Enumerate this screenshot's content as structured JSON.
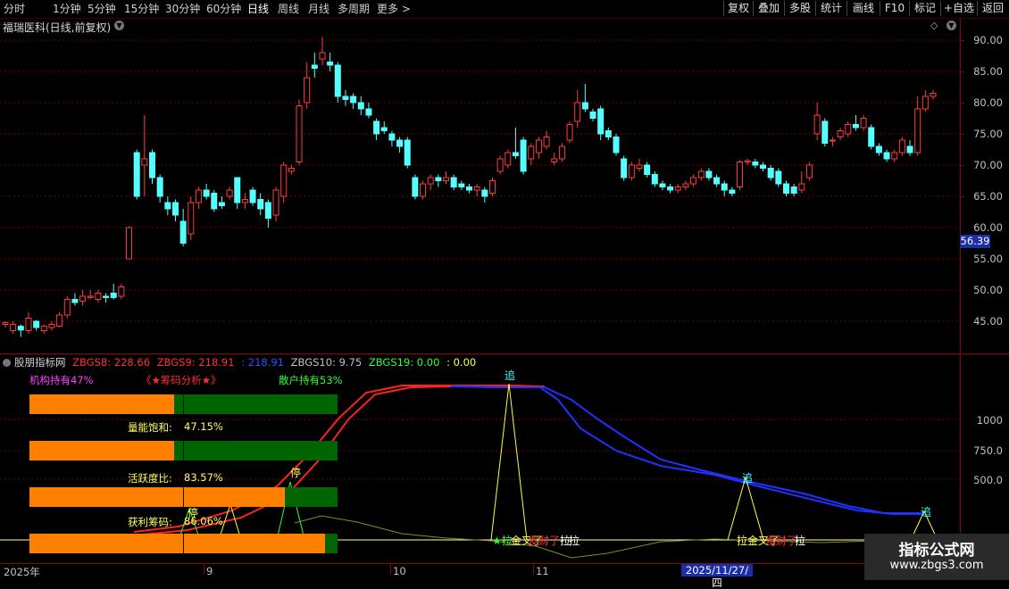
{
  "toolbar": {
    "periods": [
      "分时",
      "1分钟",
      "5分钟",
      "15分钟",
      "30分钟",
      "60分钟",
      "日线",
      "周线",
      "月线",
      "多周期",
      "更多 >"
    ],
    "active_period": "日线",
    "right_buttons": [
      "复权",
      "叠加",
      "多股",
      "统计",
      "画线",
      "F10",
      "标记",
      "+自选",
      "返回"
    ]
  },
  "stock": {
    "title": "福瑞医科(日线,前复权)"
  },
  "price_axis": {
    "ticks": [
      "90.00",
      "85.00",
      "80.00",
      "75.00",
      "70.00",
      "65.00",
      "60.00",
      "55.00",
      "50.00",
      "45.00"
    ],
    "current_price": "56.39"
  },
  "indicator": {
    "name": "股朋指标网",
    "header": [
      {
        "text": "ZBGS8: 228.66",
        "color": "#ff3030"
      },
      {
        "text": "ZBGS9: 218.91",
        "color": "#ff3030"
      },
      {
        "text": ": 218.91",
        "color": "#3050ff"
      },
      {
        "text": "ZBGS10: 9.75",
        "color": "#c0c0c0"
      },
      {
        "text": "ZBGS19: 0.00",
        "color": "#30ff30"
      },
      {
        "text": ": 0.00",
        "color": "#ffff40"
      }
    ],
    "axis_ticks": [
      "1000",
      "750.0",
      "500.0"
    ],
    "labels": {
      "inst": "机构持有47%",
      "chip": "《★筹码分析★》",
      "retail": "散户持有53%",
      "saturation_label": "量能饱和:",
      "saturation_value": "47.15%",
      "activity_label": "活跃度比:",
      "activity_value": "83.57%",
      "profit_label": "获利筹码:",
      "profit_value": "86.06%"
    },
    "bars": [
      {
        "fill": 0.47
      },
      {
        "fill": 0.47
      },
      {
        "fill": 0.83
      },
      {
        "fill": 0.96
      }
    ],
    "signals": {
      "zhui": "追",
      "ting": "停",
      "la": "拉",
      "jin_la": "★拉",
      "jin_sha": "金叉了",
      "fa_cai": "发财了",
      "left_la": "拉",
      "la2": "拉"
    }
  },
  "date_axis": {
    "labels": [
      "2025年",
      "9",
      "10",
      "11"
    ],
    "cursor": "2025/11/27/四"
  },
  "watermark": {
    "line1": "指标公式网",
    "line2": "www.zbgs3.com"
  },
  "colors": {
    "up": "#ff3c3c",
    "down": "#54ffff",
    "grid": "#7a0000",
    "bar_orange": "#ff7f00",
    "bar_green": "#006400"
  }
}
